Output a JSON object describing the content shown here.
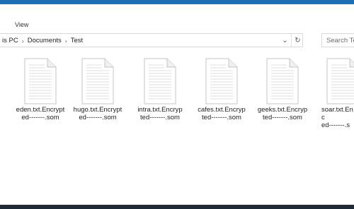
{
  "ribbon": {
    "view_tab": "View"
  },
  "breadcrumb": {
    "this_pc": "is PC",
    "documents": "Documents",
    "test": "Test"
  },
  "search": {
    "placeholder": "Search Te"
  },
  "files": [
    {
      "line1": "eden.txt.Encrypt",
      "line2": "ed-------.som"
    },
    {
      "line1": "hugo.txt.Encrypt",
      "line2": "ed-------.som"
    },
    {
      "line1": "intra.txt.Encryp",
      "line2": "ted-------.som"
    },
    {
      "line1": "cafes.txt.Encryp",
      "line2": "ted-------.som"
    },
    {
      "line1": "geeks.txt.Encryp",
      "line2": "ted-------.som"
    },
    {
      "line1": "soar.txt.Enc",
      "line2": "ed-------.s"
    }
  ]
}
